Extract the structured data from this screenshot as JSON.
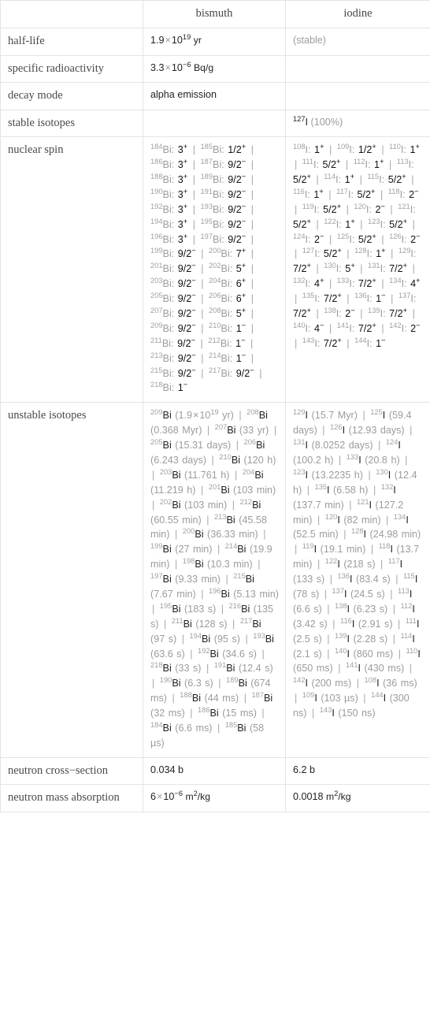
{
  "header": {
    "blank": "",
    "columns": [
      "bismuth",
      "iodine"
    ]
  },
  "rows": [
    {
      "label": "half-life",
      "bismuth_html": "1.9<times/>10<sup>19</sup> <u>yr</u>",
      "iodine_html": "<muted>(stable)</muted>"
    },
    {
      "label": "specific radioactivity",
      "bismuth_html": "3.3<times/>10<sup>-6</sup> <u>Bq/g</u>",
      "iodine_html": ""
    },
    {
      "label": "decay mode",
      "bismuth_html": "alpha emission",
      "iodine_html": ""
    },
    {
      "label": "stable isotopes",
      "bismuth_html": "",
      "iodine_html": "<iso 127 I/> <muted>(100%)</muted>"
    }
  ],
  "nuclear_spin": {
    "label": "nuclear spin",
    "bismuth": [
      {
        "isotope": "184Bi",
        "spin": "3+"
      },
      {
        "isotope": "185Bi",
        "spin": "1/2+"
      },
      {
        "isotope": "186Bi",
        "spin": "3+"
      },
      {
        "isotope": "187Bi",
        "spin": "9/2-"
      },
      {
        "isotope": "188Bi",
        "spin": "3+"
      },
      {
        "isotope": "189Bi",
        "spin": "9/2-"
      },
      {
        "isotope": "190Bi",
        "spin": "3+"
      },
      {
        "isotope": "191Bi",
        "spin": "9/2-"
      },
      {
        "isotope": "192Bi",
        "spin": "3+"
      },
      {
        "isotope": "193Bi",
        "spin": "9/2-"
      },
      {
        "isotope": "194Bi",
        "spin": "3+"
      },
      {
        "isotope": "195Bi",
        "spin": "9/2-"
      },
      {
        "isotope": "196Bi",
        "spin": "3+"
      },
      {
        "isotope": "197Bi",
        "spin": "9/2-"
      },
      {
        "isotope": "199Bi",
        "spin": "9/2-"
      },
      {
        "isotope": "200Bi",
        "spin": "7+"
      },
      {
        "isotope": "201Bi",
        "spin": "9/2-"
      },
      {
        "isotope": "202Bi",
        "spin": "5+"
      },
      {
        "isotope": "203Bi",
        "spin": "9/2-"
      },
      {
        "isotope": "204Bi",
        "spin": "6+"
      },
      {
        "isotope": "205Bi",
        "spin": "9/2-"
      },
      {
        "isotope": "206Bi",
        "spin": "6+"
      },
      {
        "isotope": "207Bi",
        "spin": "9/2-"
      },
      {
        "isotope": "208Bi",
        "spin": "5+"
      },
      {
        "isotope": "209Bi",
        "spin": "9/2-"
      },
      {
        "isotope": "210Bi",
        "spin": "1-"
      },
      {
        "isotope": "211Bi",
        "spin": "9/2-"
      },
      {
        "isotope": "212Bi",
        "spin": "1-"
      },
      {
        "isotope": "213Bi",
        "spin": "9/2-"
      },
      {
        "isotope": "214Bi",
        "spin": "1-"
      },
      {
        "isotope": "215Bi",
        "spin": "9/2-"
      },
      {
        "isotope": "217Bi",
        "spin": "9/2-"
      },
      {
        "isotope": "218Bi",
        "spin": "1-"
      }
    ],
    "iodine": [
      {
        "isotope": "108I",
        "spin": "1+"
      },
      {
        "isotope": "109I",
        "spin": "1/2+"
      },
      {
        "isotope": "110I",
        "spin": "1+"
      },
      {
        "isotope": "111I",
        "spin": "5/2+"
      },
      {
        "isotope": "112I",
        "spin": "1+"
      },
      {
        "isotope": "113I",
        "spin": "5/2+"
      },
      {
        "isotope": "114I",
        "spin": "1+"
      },
      {
        "isotope": "115I",
        "spin": "5/2+"
      },
      {
        "isotope": "116I",
        "spin": "1+"
      },
      {
        "isotope": "117I",
        "spin": "5/2+"
      },
      {
        "isotope": "118I",
        "spin": "2-"
      },
      {
        "isotope": "119I",
        "spin": "5/2+"
      },
      {
        "isotope": "120I",
        "spin": "2-"
      },
      {
        "isotope": "121I",
        "spin": "5/2+"
      },
      {
        "isotope": "122I",
        "spin": "1+"
      },
      {
        "isotope": "123I",
        "spin": "5/2+"
      },
      {
        "isotope": "124I",
        "spin": "2-"
      },
      {
        "isotope": "125I",
        "spin": "5/2+"
      },
      {
        "isotope": "126I",
        "spin": "2-"
      },
      {
        "isotope": "127I",
        "spin": "5/2+"
      },
      {
        "isotope": "128I",
        "spin": "1+"
      },
      {
        "isotope": "129I",
        "spin": "7/2+"
      },
      {
        "isotope": "130I",
        "spin": "5+"
      },
      {
        "isotope": "131I",
        "spin": "7/2+"
      },
      {
        "isotope": "132I",
        "spin": "4+"
      },
      {
        "isotope": "133I",
        "spin": "7/2+"
      },
      {
        "isotope": "134I",
        "spin": "4+"
      },
      {
        "isotope": "135I",
        "spin": "7/2+"
      },
      {
        "isotope": "136I",
        "spin": "1-"
      },
      {
        "isotope": "137I",
        "spin": "7/2+"
      },
      {
        "isotope": "138I",
        "spin": "2-"
      },
      {
        "isotope": "139I",
        "spin": "7/2+"
      },
      {
        "isotope": "140I",
        "spin": "4-"
      },
      {
        "isotope": "141I",
        "spin": "7/2+"
      },
      {
        "isotope": "142I",
        "spin": "2-"
      },
      {
        "isotope": "143I",
        "spin": "7/2+"
      },
      {
        "isotope": "144I",
        "spin": "1-"
      }
    ]
  },
  "unstable_isotopes": {
    "label": "unstable isotopes",
    "bismuth": [
      {
        "isotope": "209Bi",
        "half_life": "1.9×10^19 yr"
      },
      {
        "isotope": "208Bi",
        "half_life": "0.368 Myr"
      },
      {
        "isotope": "207Bi",
        "half_life": "33 yr"
      },
      {
        "isotope": "205Bi",
        "half_life": "15.31 days"
      },
      {
        "isotope": "206Bi",
        "half_life": "6.243 days"
      },
      {
        "isotope": "210Bi",
        "half_life": "120 h"
      },
      {
        "isotope": "203Bi",
        "half_life": "11.761 h"
      },
      {
        "isotope": "204Bi",
        "half_life": "11.219 h"
      },
      {
        "isotope": "201Bi",
        "half_life": "103 min"
      },
      {
        "isotope": "202Bi",
        "half_life": "103 min"
      },
      {
        "isotope": "212Bi",
        "half_life": "60.55 min"
      },
      {
        "isotope": "213Bi",
        "half_life": "45.58 min"
      },
      {
        "isotope": "200Bi",
        "half_life": "36.33 min"
      },
      {
        "isotope": "199Bi",
        "half_life": "27 min"
      },
      {
        "isotope": "214Bi",
        "half_life": "19.9 min"
      },
      {
        "isotope": "198Bi",
        "half_life": "10.3 min"
      },
      {
        "isotope": "197Bi",
        "half_life": "9.33 min"
      },
      {
        "isotope": "215Bi",
        "half_life": "7.67 min"
      },
      {
        "isotope": "196Bi",
        "half_life": "5.13 min"
      },
      {
        "isotope": "195Bi",
        "half_life": "183 s"
      },
      {
        "isotope": "216Bi",
        "half_life": "135 s"
      },
      {
        "isotope": "211Bi",
        "half_life": "128 s"
      },
      {
        "isotope": "217Bi",
        "half_life": "97 s"
      },
      {
        "isotope": "194Bi",
        "half_life": "95 s"
      },
      {
        "isotope": "193Bi",
        "half_life": "63.6 s"
      },
      {
        "isotope": "192Bi",
        "half_life": "34.6 s"
      },
      {
        "isotope": "218Bi",
        "half_life": "33 s"
      },
      {
        "isotope": "191Bi",
        "half_life": "12.4 s"
      },
      {
        "isotope": "190Bi",
        "half_life": "6.3 s"
      },
      {
        "isotope": "189Bi",
        "half_life": "674 ms"
      },
      {
        "isotope": "188Bi",
        "half_life": "44 ms"
      },
      {
        "isotope": "187Bi",
        "half_life": "32 ms"
      },
      {
        "isotope": "186Bi",
        "half_life": "15 ms"
      },
      {
        "isotope": "184Bi",
        "half_life": "6.6 ms"
      },
      {
        "isotope": "185Bi",
        "half_life": "58 µs"
      }
    ],
    "iodine": [
      {
        "isotope": "129I",
        "half_life": "15.7 Myr"
      },
      {
        "isotope": "125I",
        "half_life": "59.4 days"
      },
      {
        "isotope": "126I",
        "half_life": "12.93 days"
      },
      {
        "isotope": "131I",
        "half_life": "8.0252 days"
      },
      {
        "isotope": "124I",
        "half_life": "100.2 h"
      },
      {
        "isotope": "133I",
        "half_life": "20.8 h"
      },
      {
        "isotope": "123I",
        "half_life": "13.2235 h"
      },
      {
        "isotope": "130I",
        "half_life": "12.4 h"
      },
      {
        "isotope": "135I",
        "half_life": "6.58 h"
      },
      {
        "isotope": "132I",
        "half_life": "137.7 min"
      },
      {
        "isotope": "121I",
        "half_life": "127.2 min"
      },
      {
        "isotope": "120I",
        "half_life": "82 min"
      },
      {
        "isotope": "134I",
        "half_life": "52.5 min"
      },
      {
        "isotope": "128I",
        "half_life": "24.98 min"
      },
      {
        "isotope": "119I",
        "half_life": "19.1 min"
      },
      {
        "isotope": "118I",
        "half_life": "13.7 min"
      },
      {
        "isotope": "122I",
        "half_life": "218 s"
      },
      {
        "isotope": "117I",
        "half_life": "133 s"
      },
      {
        "isotope": "136I",
        "half_life": "83.4 s"
      },
      {
        "isotope": "115I",
        "half_life": "78 s"
      },
      {
        "isotope": "137I",
        "half_life": "24.5 s"
      },
      {
        "isotope": "113I",
        "half_life": "6.6 s"
      },
      {
        "isotope": "138I",
        "half_life": "6.23 s"
      },
      {
        "isotope": "112I",
        "half_life": "3.42 s"
      },
      {
        "isotope": "116I",
        "half_life": "2.91 s"
      },
      {
        "isotope": "111I",
        "half_life": "2.5 s"
      },
      {
        "isotope": "139I",
        "half_life": "2.28 s"
      },
      {
        "isotope": "114I",
        "half_life": "2.1 s"
      },
      {
        "isotope": "140I",
        "half_life": "860 ms"
      },
      {
        "isotope": "110I",
        "half_life": "650 ms"
      },
      {
        "isotope": "141I",
        "half_life": "430 ms"
      },
      {
        "isotope": "142I",
        "half_life": "200 ms"
      },
      {
        "isotope": "108I",
        "half_life": "36 ms"
      },
      {
        "isotope": "109I",
        "half_life": "103 µs"
      },
      {
        "isotope": "144I",
        "half_life": "300 ns"
      },
      {
        "isotope": "143I",
        "half_life": "150 ns"
      }
    ]
  },
  "bottom_rows": [
    {
      "label": "neutron cross-section",
      "bismuth": "0.034 b",
      "iodine": "6.2 b"
    },
    {
      "label": "neutron mass absorption",
      "bismuth_html": "6<times/>10<sup>-6</sup> <u>m<sup>2</sup>/kg</u>",
      "iodine_html": "0.0018 <u>m<sup>2</sup>/kg</u>"
    }
  ],
  "simple_values": {
    "half_life_bi_mantissa": "1.9",
    "half_life_bi_base": "10",
    "half_life_bi_exp": "19",
    "half_life_bi_unit": "yr",
    "half_life_i": "(stable)",
    "spec_radio_bi_mantissa": "3.3",
    "spec_radio_bi_base": "10",
    "spec_radio_bi_exp": "−6",
    "spec_radio_bi_unit": "Bq/g",
    "decay_mode_bi": "alpha emission",
    "stable_iso_i_mass": "127",
    "stable_iso_i_sym": "I",
    "stable_iso_i_pct": "(100%)",
    "ncs_label": "neutron cross−section",
    "ncs_bi": "0.034 b",
    "ncs_i": "6.2 b",
    "nma_label": "neutron mass absorption",
    "nma_bi_mantissa": "6",
    "nma_bi_base": "10",
    "nma_bi_exp": "−6",
    "nma_bi_unit_m": "m",
    "nma_bi_unit_exp": "2",
    "nma_bi_unit_kg": "/kg",
    "nma_i_value": "0.0018",
    "nma_i_unit_m": "m",
    "nma_i_unit_exp": "2",
    "nma_i_unit_kg": "/kg",
    "row_labels": {
      "half_life": "half-life",
      "specific_radioactivity": "specific radioactivity",
      "decay_mode": "decay mode",
      "stable_isotopes": "stable isotopes",
      "nuclear_spin": "nuclear spin",
      "unstable_isotopes": "unstable isotopes"
    }
  },
  "colors": {
    "border": "#e4e4e4",
    "text_dark": "#222222",
    "text_muted": "#9c9c9c",
    "label": "#4a4a4a"
  }
}
